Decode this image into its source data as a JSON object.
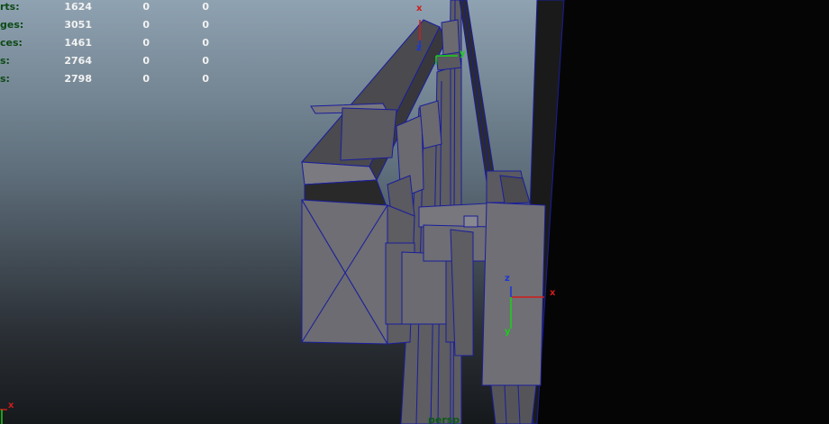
{
  "hud": {
    "rows": [
      {
        "label": "rts:",
        "v1": "1624",
        "v2": "0",
        "v3": "0"
      },
      {
        "label": "ges:",
        "v1": "3051",
        "v2": "0",
        "v3": "0"
      },
      {
        "label": "ces:",
        "v1": "1461",
        "v2": "0",
        "v3": "0"
      },
      {
        "label": "s:",
        "v1": "2764",
        "v2": "0",
        "v3": "0"
      },
      {
        "label": "s:",
        "v1": "2798",
        "v2": "0",
        "v3": "0"
      }
    ]
  },
  "gizmos": {
    "top": {
      "x": "x",
      "y": "y",
      "z": "z"
    },
    "bottom": {
      "x": "x",
      "y": "y",
      "z": "z"
    },
    "corner": {
      "x": "x"
    }
  },
  "camera": {
    "name": "persp"
  },
  "colors": {
    "hud_label": "#0d4a16",
    "hud_value": "#f2f2f2",
    "axis_x": "#d11b1b",
    "axis_y": "#18d018",
    "axis_z": "#1b35d8",
    "wire": "#1a1d9c",
    "face": "#6d6d72"
  }
}
